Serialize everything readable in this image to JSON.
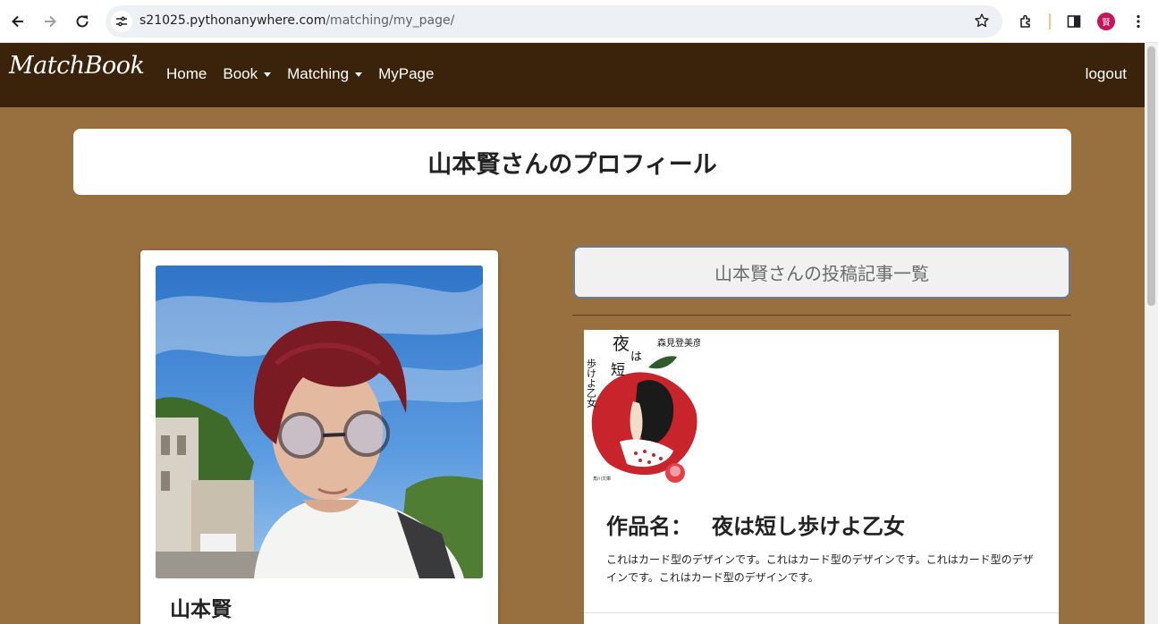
{
  "browser": {
    "url_host": "s21025.pythonanywhere.com",
    "url_path": "/matching/my_page/",
    "profile_initial": "賢"
  },
  "nav": {
    "brand": "MatchBook",
    "links": [
      {
        "label": "Home",
        "dropdown": false
      },
      {
        "label": "Book",
        "dropdown": true
      },
      {
        "label": "Matching",
        "dropdown": true
      },
      {
        "label": "MyPage",
        "dropdown": false
      }
    ],
    "logout": "logout"
  },
  "page": {
    "title": "山本賢さんのプロフィール"
  },
  "profile": {
    "name": "山本賢"
  },
  "posts": {
    "header": "山本賢さんの投稿記事一覧",
    "items": [
      {
        "title_prefix": "作品名：",
        "title": "夜は短し歩けよ乙女",
        "text": "これはカード型のデザインです。これはカード型のデザインです。これはカード型のデザインです。これはカード型のデザインです。",
        "cover_author": "森見登美彦",
        "cover_title": "夜は短し歩けよ乙女"
      }
    ]
  },
  "colors": {
    "page_bg": "#98703f",
    "navbar_bg": "#3b220a",
    "card_bg": "#ffffff"
  }
}
